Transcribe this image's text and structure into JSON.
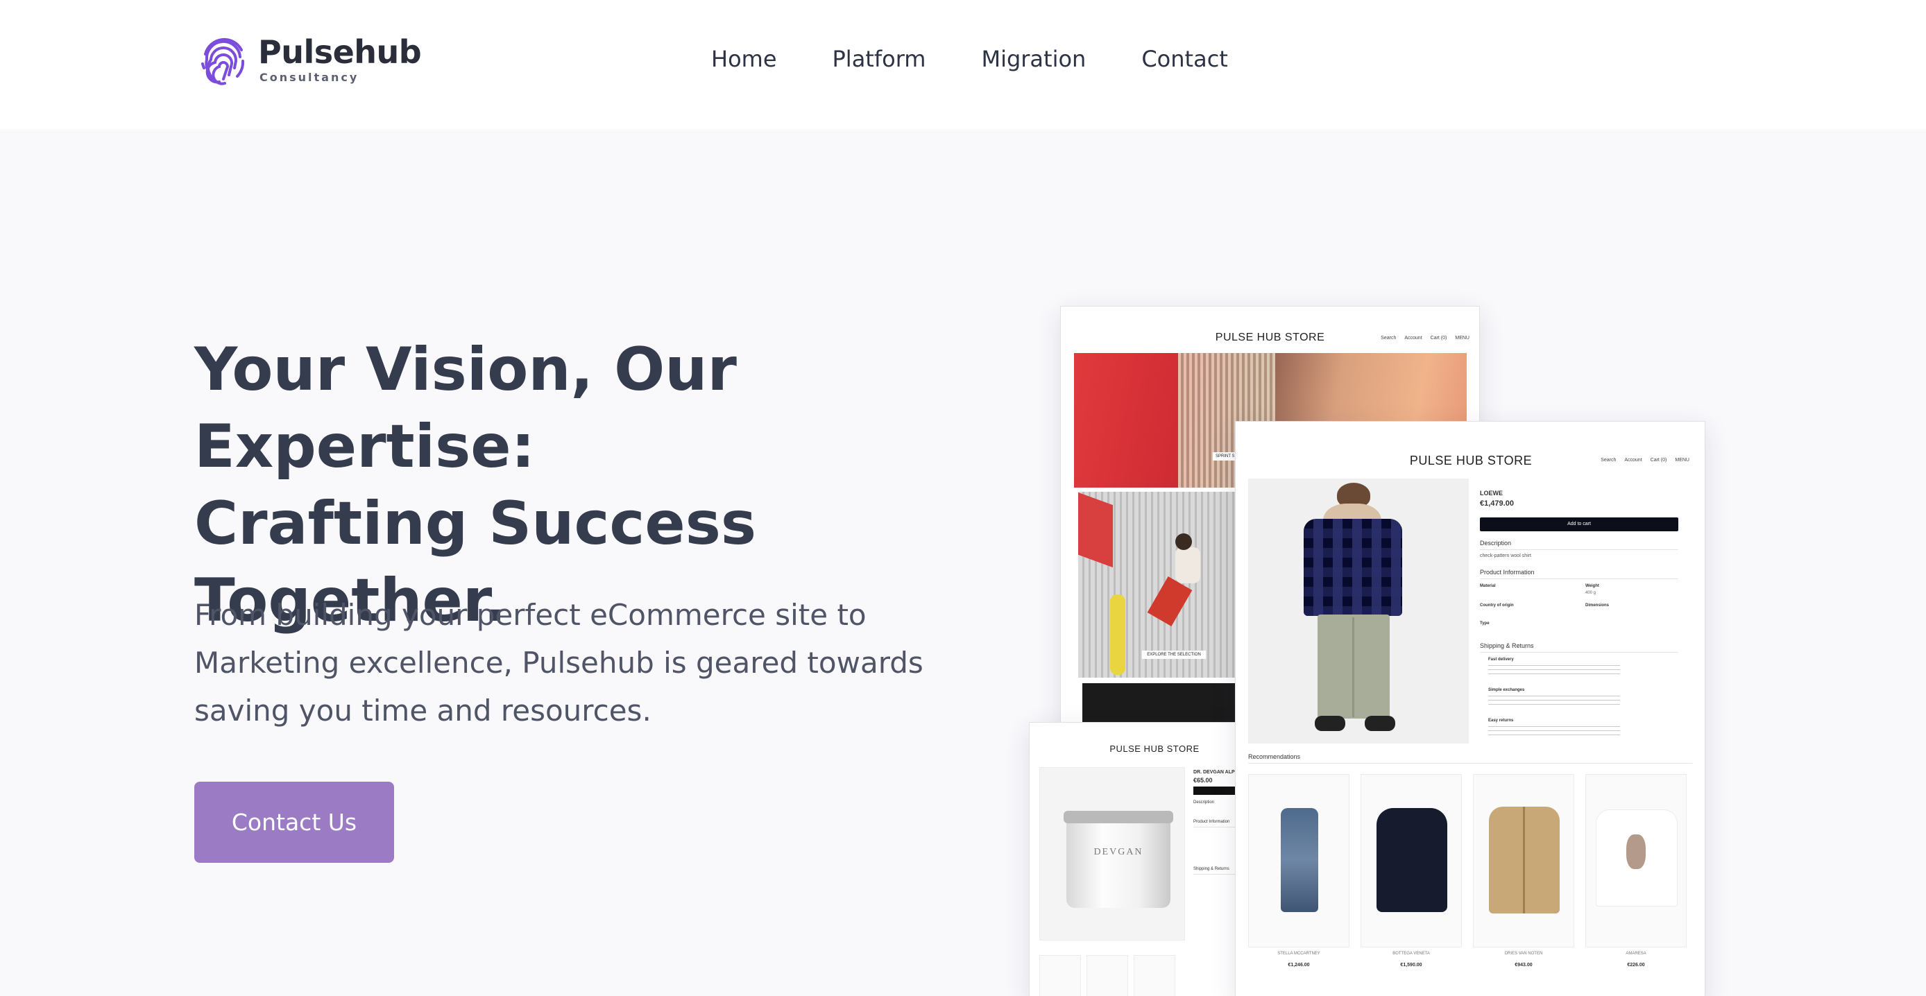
{
  "brand": {
    "name": "Pulsehub",
    "tagline": "Consultancy",
    "accent": "#7c4ddb"
  },
  "nav": {
    "items": [
      "Home",
      "Platform",
      "Migration",
      "Contact"
    ]
  },
  "hero": {
    "title": "Your Vision, Our Expertise: Crafting Success Together.",
    "subtitle": "From building your perfect eCommerce site to Marketing excellence, Pulsehub is geared towards saving you time and resources.",
    "cta_label": "Contact Us",
    "cta_color": "#9b7bc4"
  },
  "mockups": {
    "store_title": "PULSE HUB STORE",
    "store_links": [
      "Search",
      "Account",
      "Cart (0)",
      "MENU"
    ],
    "product": {
      "brand": "LOEWE",
      "price": "€1,479.00",
      "add_to_cart": "Add to cart",
      "description_heading": "Description",
      "description": "check-pattern wool shirt",
      "info_heading": "Product Information",
      "info_labels": [
        "Material",
        "Weight",
        "Country of origin",
        "Dimensions",
        "Type"
      ],
      "weight_value": "400 g",
      "shipping_heading": "Shipping & Returns",
      "shipping_items": [
        "Fast delivery",
        "Simple exchanges",
        "Easy returns"
      ],
      "recommendations_heading": "Recommendations",
      "recommendations": [
        {
          "brand": "STELLA MCCARTNEY",
          "price": "€1,246.00"
        },
        {
          "brand": "BOTTEGA VENETA",
          "price": "€1,590.00"
        },
        {
          "brand": "DRIES VAN NOTEN",
          "price": "€943.00"
        },
        {
          "brand": "AMARESA",
          "price": "€226.00"
        }
      ]
    },
    "back_page": {
      "explore_label": "EXPLORE THE SELECTION",
      "banner_button": "SPRINT S"
    },
    "bottom_page": {
      "product_brand": "DR. DEVGAN ALPH",
      "price": "€65.00",
      "jar_label": "DEVGAN",
      "description_heading": "Description",
      "info_heading": "Product Information",
      "shipping_heading": "Shipping & Returns"
    }
  }
}
